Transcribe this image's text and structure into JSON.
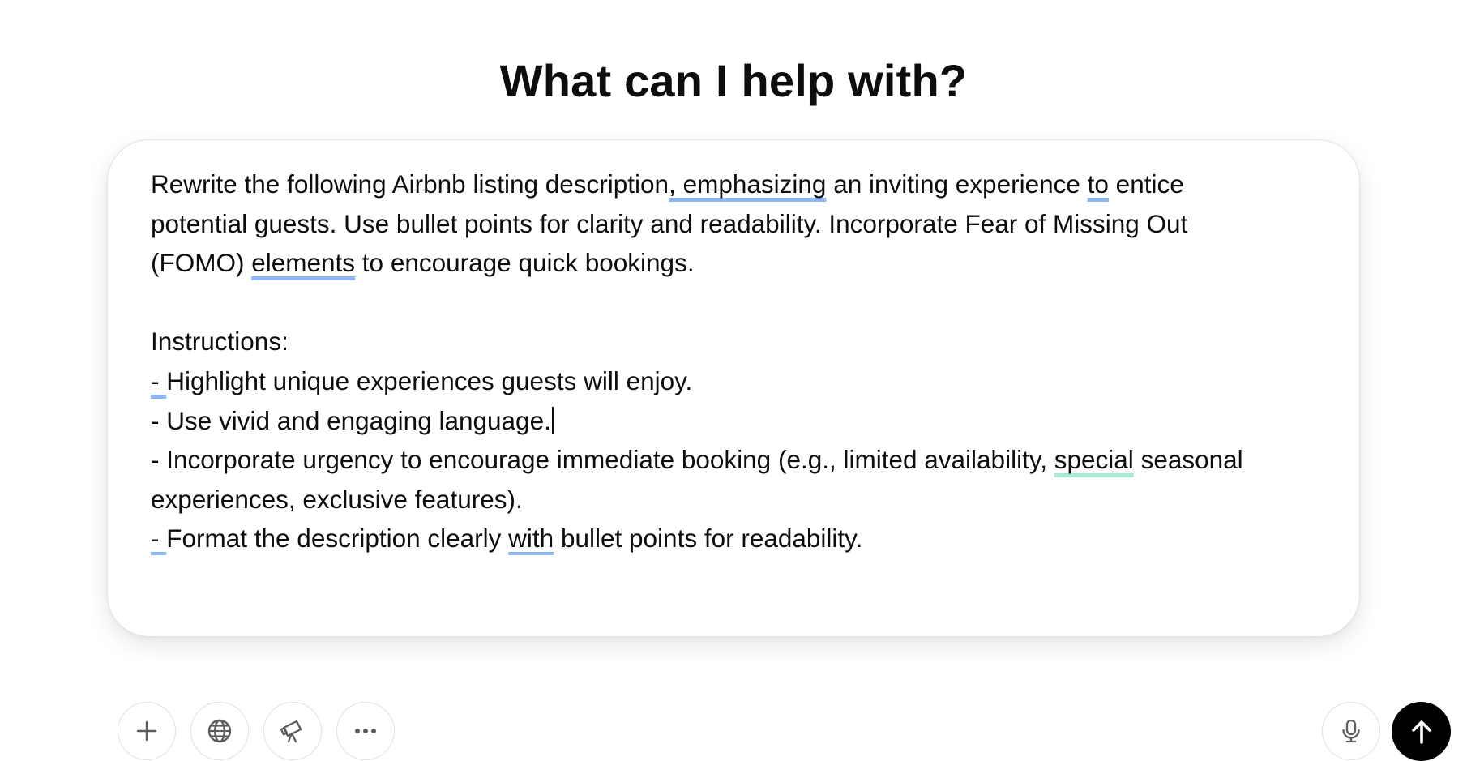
{
  "page": {
    "heading": "What can I help with?"
  },
  "composer": {
    "lines": [
      [
        {
          "t": "Rewrite the following Airbnb listing description"
        },
        {
          "t": ", emphasizing",
          "mark": "blue"
        },
        {
          "t": " an inviting experience "
        },
        {
          "t": "to",
          "mark": "blue"
        },
        {
          "t": " entice"
        }
      ],
      [
        {
          "t": "potential guests. Use bullet points for clarity and readability. Incorporate Fear of Missing Out"
        }
      ],
      [
        {
          "t": "(FOMO) "
        },
        {
          "t": "elements",
          "mark": "blue"
        },
        {
          "t": " to encourage quick bookings."
        }
      ],
      [],
      [
        {
          "t": "Instructions:"
        }
      ],
      [
        {
          "t": "- ",
          "mark": "blue"
        },
        {
          "t": "Highlight unique experiences guests will enjoy."
        }
      ],
      [
        {
          "t": "- Use vivid and engaging language."
        },
        {
          "caret": true
        }
      ],
      [
        {
          "t": "- Incorporate urgency to encourage immediate booking (e.g., limited availability, "
        },
        {
          "t": "special",
          "mark": "green"
        },
        {
          "t": " seasonal"
        }
      ],
      [
        {
          "t": "experiences, exclusive features)."
        }
      ],
      [
        {
          "t": "- ",
          "mark": "blue"
        },
        {
          "t": "Format the description clearly "
        },
        {
          "t": "with",
          "mark": "blue"
        },
        {
          "t": " bullet points for readability."
        }
      ]
    ],
    "left_tools": [
      {
        "name": "add-attachment-button",
        "icon": "plus-icon"
      },
      {
        "name": "web-search-button",
        "icon": "globe-icon"
      },
      {
        "name": "deep-research-button",
        "icon": "telescope-icon"
      },
      {
        "name": "more-tools-button",
        "icon": "more-horizontal-icon"
      }
    ],
    "right_tools": [
      {
        "name": "voice-input-button",
        "icon": "microphone-icon"
      },
      {
        "name": "send-button",
        "icon": "arrow-up-icon"
      }
    ]
  },
  "colors": {
    "spell_underline": "#8fb6f4",
    "grammar_underline": "#a8ecd8",
    "send_background": "#000000",
    "icon_gray": "#5d5d5d"
  }
}
